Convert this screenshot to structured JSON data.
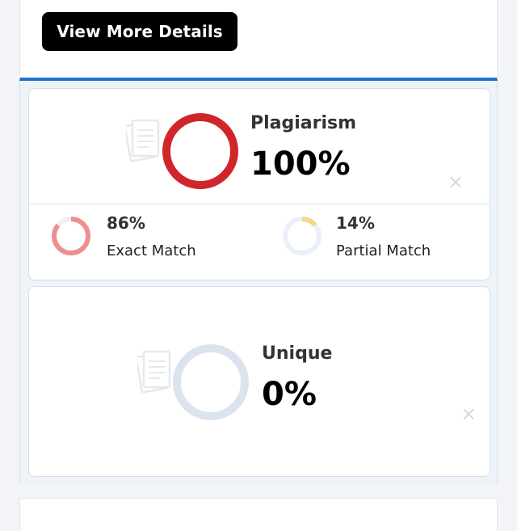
{
  "top": {
    "button_label": "View More Details"
  },
  "plagiarism": {
    "label": "Plagiarism",
    "value": "100%",
    "ring_color": "#d1252c",
    "exact": {
      "value": "86%",
      "label": "Exact Match",
      "color": "#ef8f8f"
    },
    "partial": {
      "value": "14%",
      "label": "Partial Match",
      "color": "#f7d58a"
    }
  },
  "unique": {
    "label": "Unique",
    "value": "0%",
    "ring_color": "#dbe3ee"
  },
  "colors": {
    "accent": "#1f6fd1"
  }
}
